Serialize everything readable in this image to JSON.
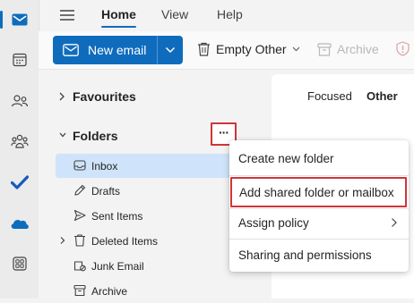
{
  "rail": [
    {
      "name": "mail",
      "icon": "mail-icon",
      "color": "#0f6cbd"
    },
    {
      "name": "calendar",
      "icon": "calendar-icon"
    },
    {
      "name": "people",
      "icon": "people-icon"
    },
    {
      "name": "groups",
      "icon": "groups-icon"
    },
    {
      "name": "todo",
      "icon": "todo-check-icon",
      "color": "#185abd"
    },
    {
      "name": "onedrive",
      "icon": "onedrive-cloud-icon",
      "color": "#0f6cbd"
    },
    {
      "name": "apps",
      "icon": "apps-grid-icon"
    }
  ],
  "topbar": {
    "tabs": [
      "Home",
      "View",
      "Help"
    ],
    "selected_tab": "Home"
  },
  "ribbon": {
    "new_email": "New email",
    "empty_other": "Empty Other",
    "archive": "Archive"
  },
  "folders": {
    "favourites": "Favourites",
    "folders_heading": "Folders",
    "more_options": "···",
    "items": [
      {
        "label": "Inbox",
        "icon": "inbox-icon",
        "selected": true
      },
      {
        "label": "Drafts",
        "icon": "drafts-pencil-icon"
      },
      {
        "label": "Sent Items",
        "icon": "send-icon"
      },
      {
        "label": "Deleted Items",
        "icon": "trash-icon",
        "expandable": true
      },
      {
        "label": "Junk Email",
        "icon": "junk-icon"
      },
      {
        "label": "Archive",
        "icon": "archive-box-icon"
      }
    ]
  },
  "message_list": {
    "tabs": [
      "Focused",
      "Other"
    ],
    "selected_tab": "Other"
  },
  "context_menu": {
    "items": [
      "Create new folder",
      "Add shared folder or mailbox",
      "Assign policy",
      "Sharing and permissions"
    ],
    "highlighted": "Add shared folder or mailbox",
    "highlight_color": "#d13438"
  },
  "accent": "#0f6cbd"
}
